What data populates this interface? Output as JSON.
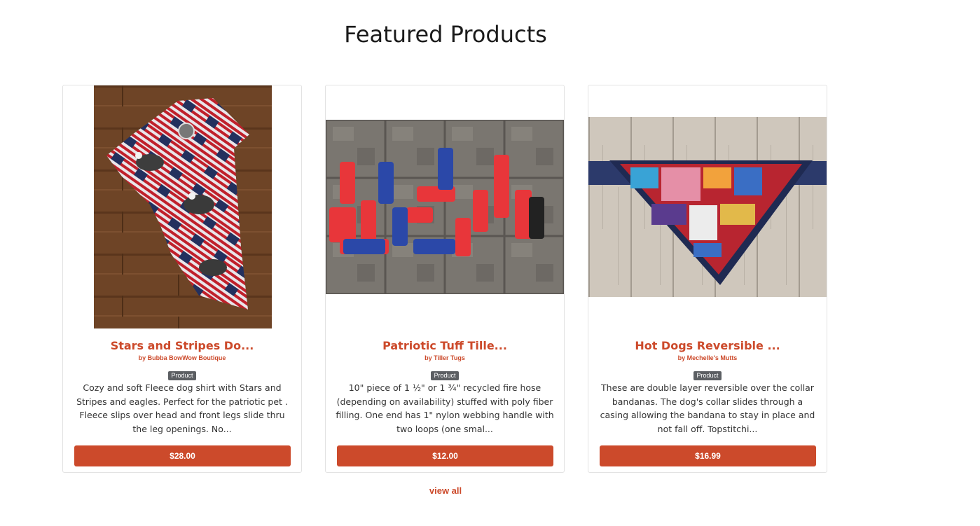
{
  "section": {
    "title": "Featured Products"
  },
  "products": [
    {
      "name": "Stars and Stripes Do...",
      "vendor": "by Bubba BowWow Boutique",
      "badge": "Product",
      "description": "Cozy and soft Fleece dog shirt with Stars and Stripes and eagles. Perfect for the patriotic pet . Fleece slips over head and front legs slide thru the leg openings. No...",
      "price": "$28.00"
    },
    {
      "name": "Patriotic Tuff Tille...",
      "vendor": "by Tiller Tugs",
      "badge": "Product",
      "description": "10\" piece of 1 ½\" or 1 ¾\" recycled fire hose (depending on availability) stuffed with poly fiber filling. One end has 1\" nylon webbing handle with two loops (one smal...",
      "price": "$12.00"
    },
    {
      "name": "Hot Dogs Reversible ...",
      "vendor": "by Mechelle's Mutts",
      "badge": "Product",
      "description": "These are double layer reversible over the collar bandanas. The dog's collar slides through a casing allowing the bandana to stay in place and not fall off. Topstitchi...",
      "price": "$16.99"
    }
  ],
  "footer": {
    "view_all_label": "view all"
  },
  "colors": {
    "accent": "#cc4a2b",
    "badge": "#5c5f63",
    "border": "#e2e2e2"
  }
}
